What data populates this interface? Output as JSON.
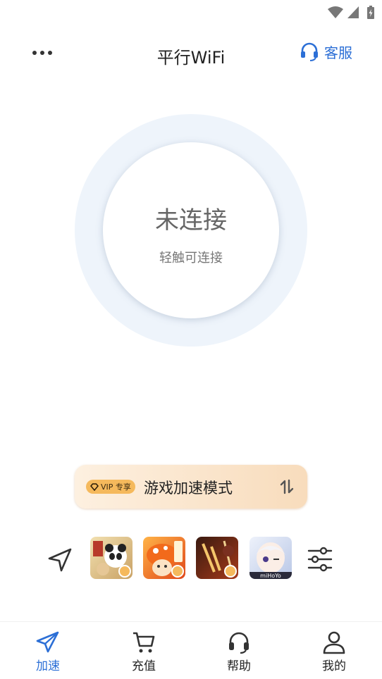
{
  "header": {
    "title": "平行WiFi",
    "service_label": "客服"
  },
  "connect": {
    "status": "未连接",
    "hint": "轻触可连接"
  },
  "mode": {
    "vip_badge": "VIP 专享",
    "label": "游戏加速模式"
  },
  "games": [
    {
      "name": "game-1",
      "color": "#e8c98a"
    },
    {
      "name": "game-2",
      "color": "#f07a2a"
    },
    {
      "name": "game-3",
      "color": "#5a2a1a"
    },
    {
      "name": "game-4",
      "color": "#dfe6f2",
      "caption": "miHoYo"
    }
  ],
  "tabs": [
    {
      "label": "加速",
      "icon": "paper-plane-icon",
      "active": true
    },
    {
      "label": "充值",
      "icon": "cart-icon",
      "active": false
    },
    {
      "label": "帮助",
      "icon": "headset-icon",
      "active": false
    },
    {
      "label": "我的",
      "icon": "user-icon",
      "active": false
    }
  ],
  "colors": {
    "accent": "#2c6fd6",
    "ring": "#eef4fb",
    "vip_gold": "#f5b95c"
  }
}
